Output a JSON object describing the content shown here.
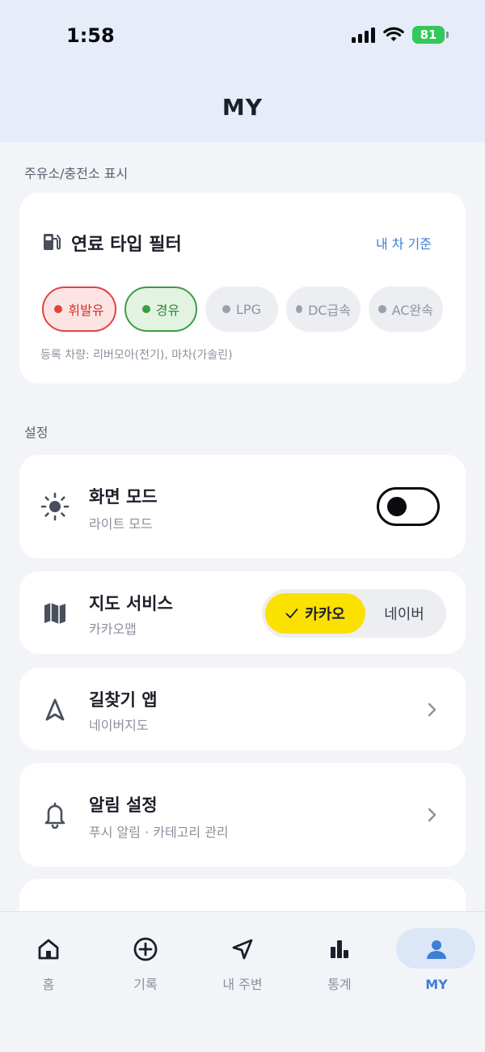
{
  "status_bar": {
    "time": "1:58",
    "battery": "81"
  },
  "header": {
    "title": "MY"
  },
  "fuel_section": {
    "label": "주유소/충전소 표시",
    "title": "연료 타입 필터",
    "link": "내 차 기준",
    "chips": [
      {
        "label": "휘발유",
        "state": "selected",
        "color": "#e1443d"
      },
      {
        "label": "경유",
        "state": "selected",
        "color": "#3c9d44"
      },
      {
        "label": "LPG",
        "state": "off"
      },
      {
        "label": "DC급속",
        "state": "off"
      },
      {
        "label": "AC완속",
        "state": "off"
      }
    ],
    "note": "등록 차량: 리버모아(전기), 마차(가솔린)"
  },
  "settings": {
    "label": "설정",
    "screen_mode": {
      "title": "화면 모드",
      "sub": "라이트 모드",
      "toggle_on": false,
      "icon": "sun-icon"
    },
    "map_service": {
      "title": "지도 서비스",
      "sub": "카카오맵",
      "option_on": "카카오",
      "option_off": "네이버",
      "icon": "map-icon",
      "accent": "#fae100"
    },
    "navigation": {
      "title": "길찾기 앱",
      "sub": "네이버지도",
      "icon": "navigation-arrow-icon"
    },
    "notifications": {
      "title": "알림 설정",
      "sub": "푸시 알림 · 카테고리 관리",
      "icon": "bell-icon"
    }
  },
  "tabbar": {
    "items": [
      {
        "label": "홈",
        "icon": "home-icon"
      },
      {
        "label": "기록",
        "icon": "plus-circle-icon"
      },
      {
        "label": "내 주변",
        "icon": "location-arrow-icon"
      },
      {
        "label": "통계",
        "icon": "bar-chart-icon"
      },
      {
        "label": "MY",
        "icon": "person-icon",
        "active": true
      }
    ],
    "active_color": "#3d7fd6"
  }
}
